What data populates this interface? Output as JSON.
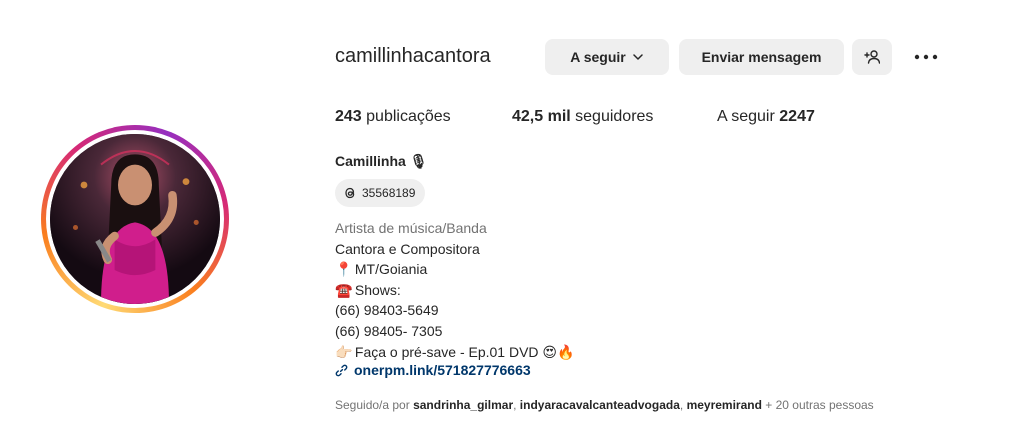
{
  "profile": {
    "username": "camillinhacantora",
    "full_name": "Camillinha",
    "full_name_emoji": "🎙",
    "threads_count": "35568189"
  },
  "actions": {
    "follow_label": "A seguir",
    "message_label": "Enviar mensagem"
  },
  "stats": {
    "posts_value": "243",
    "posts_label": "publicações",
    "followers_value": "42,5 mil",
    "followers_label": "seguidores",
    "following_label": "A seguir",
    "following_value": "2247"
  },
  "bio": {
    "category": "Artista de música/Banda",
    "lines": [
      {
        "emoji": "",
        "text": "Cantora e Compositora"
      },
      {
        "emoji": "📍",
        "text": "MT/Goiania"
      },
      {
        "emoji": "☎️",
        "text": "Shows:"
      },
      {
        "emoji": "",
        "text": "(66) 98403-5649"
      },
      {
        "emoji": "",
        "text": "(66) 98405- 7305"
      },
      {
        "emoji": "👉🏻",
        "text": "Faça o pré-save - Ep.01 DVD 😍🔥"
      }
    ],
    "link": "onerpm.link/571827776663"
  },
  "followed_by": {
    "prefix": "Seguido/a por",
    "user1": "sandrinha_gilmar",
    "sep1": ",",
    "user2": "indyaracavalcanteadvogada",
    "sep2": ",",
    "user3": "meyremirand",
    "suffix": "+ 20 outras pessoas"
  },
  "colors": {
    "link": "#00376b",
    "button_bg": "#efefef",
    "muted_text": "#737373"
  }
}
